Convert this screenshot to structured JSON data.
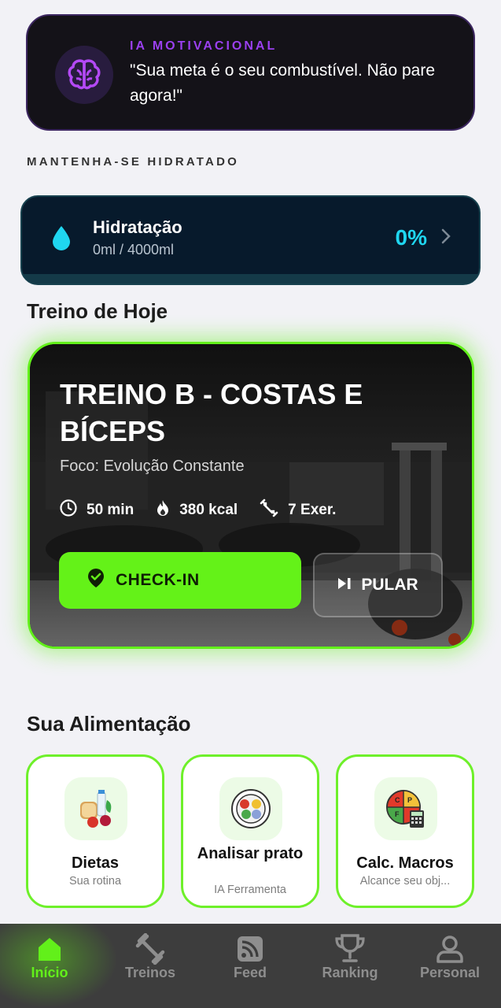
{
  "motivation": {
    "tag": "IA MOTIVACIONAL",
    "quote": "\"Sua meta é o seu combustível. Não pare agora!\"",
    "icon": "brain-icon"
  },
  "hydration_section": {
    "caption": "MANTENHA-SE HIDRATADO",
    "title": "Hidratação",
    "amount": "0ml / 4000ml",
    "percent": "0%",
    "progress": 0
  },
  "workout": {
    "section_title": "Treino de Hoje",
    "title": "TREINO B - COSTAS E BÍCEPS",
    "focus": "Foco: Evolução Constante",
    "duration": "50 min",
    "calories": "380 kcal",
    "exercises": "7 Exer.",
    "checkin_label": "CHECK-IN",
    "skip_label": "PULAR"
  },
  "food": {
    "section_title": "Sua Alimentação",
    "cards": [
      {
        "label": "Dietas",
        "sub": "Sua rotina"
      },
      {
        "label": "Analisar prato",
        "sub": "IA Ferramenta"
      },
      {
        "label": "Calc. Macros",
        "sub": "Alcance seu obj..."
      }
    ]
  },
  "nav": {
    "items": [
      {
        "label": "Início",
        "active": true
      },
      {
        "label": "Treinos"
      },
      {
        "label": "Feed"
      },
      {
        "label": "Ranking"
      },
      {
        "label": "Personal"
      }
    ]
  },
  "colors": {
    "accent": "#62f01a",
    "purple": "#9b40f0",
    "cyan": "#1fd6f0"
  }
}
